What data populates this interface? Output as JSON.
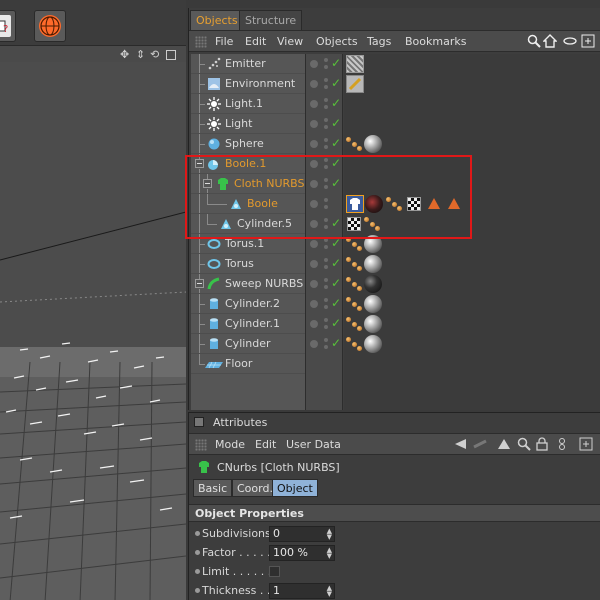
{
  "object_manager": {
    "tabs": [
      "Objects",
      "Structure"
    ],
    "menu": [
      "File",
      "Edit",
      "View",
      "Objects",
      "Tags",
      "Bookmarks"
    ],
    "rows": [
      {
        "name": "Emitter",
        "icon": "emitter-icon",
        "tags": [
          "hatch"
        ]
      },
      {
        "name": "Environment",
        "icon": "environment-icon",
        "tags": [
          "pencil"
        ]
      },
      {
        "name": "Light.1",
        "icon": "light-icon",
        "tags": []
      },
      {
        "name": "Light",
        "icon": "light-icon",
        "tags": []
      },
      {
        "name": "Sphere",
        "icon": "sphere-icon",
        "tags": [
          "texture-dots",
          "material-sphere"
        ]
      },
      {
        "name": "Boole.1",
        "icon": "boole-icon",
        "tags": []
      },
      {
        "name": "Cloth NURBS",
        "icon": "cloth-nurbs-icon",
        "tags": []
      },
      {
        "name": "Boole",
        "icon": "boole-icon",
        "tags": [
          "cloth",
          "material-red",
          "texture-dots",
          "checker",
          "triangle",
          "triangle"
        ]
      },
      {
        "name": "Cylinder.5",
        "icon": "cylinder-icon",
        "tags": [
          "checker",
          "texture-dots"
        ]
      },
      {
        "name": "Torus.1",
        "icon": "torus-icon",
        "tags": [
          "texture-dots",
          "material-sphere"
        ]
      },
      {
        "name": "Torus",
        "icon": "torus-icon",
        "tags": [
          "texture-dots",
          "material-sphere"
        ]
      },
      {
        "name": "Sweep NURBS",
        "icon": "sweep-nurbs-icon",
        "tags": [
          "texture-dots",
          "material-dark"
        ]
      },
      {
        "name": "Cylinder.2",
        "icon": "cylinder-icon",
        "tags": [
          "texture-dots",
          "material-sphere"
        ]
      },
      {
        "name": "Cylinder.1",
        "icon": "cylinder-icon",
        "tags": [
          "texture-dots",
          "material-sphere"
        ]
      },
      {
        "name": "Cylinder",
        "icon": "cylinder-icon",
        "tags": [
          "texture-dots",
          "material-sphere"
        ]
      },
      {
        "name": "Floor",
        "icon": "floor-icon",
        "tags": []
      }
    ]
  },
  "attributes": {
    "title": "Attributes",
    "menu": [
      "Mode",
      "Edit",
      "User Data"
    ],
    "object_label": "CNurbs [Cloth NURBS]",
    "tabs": [
      "Basic",
      "Coord.",
      "Object"
    ],
    "active_tab": "Object",
    "section_title": "Object Properties",
    "params": [
      {
        "label": "Subdivisions",
        "value": "0"
      },
      {
        "label": "Factor . . . . .",
        "value": "100 %"
      },
      {
        "label": "Limit . . . . . . .",
        "value": ""
      },
      {
        "label": "Thickness . .",
        "value": "1"
      }
    ]
  },
  "colors": {
    "accent_orange": "#e39a2d",
    "check_green": "#58c23a",
    "selection_red": "#e01818",
    "active_tab_blue": "#8fb2d8"
  }
}
